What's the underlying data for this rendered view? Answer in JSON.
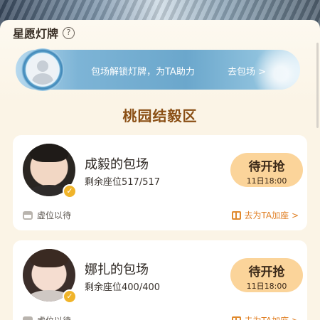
{
  "section": {
    "title": "星愿灯牌",
    "help_icon": "?"
  },
  "banner": {
    "text": "包场解锁灯牌，为TA助力",
    "link": "去包场 >",
    "avatar_icon": "default-user-avatar"
  },
  "zone_title": "桃园结毅区",
  "cards": [
    {
      "title": "成毅的包场",
      "seats": "剩余座位517/517",
      "status": "待开抢",
      "time": "11日18:00",
      "note": "虚位以待",
      "action": "去为TA加座 >",
      "verified_icon": "verified-badge"
    },
    {
      "title": "娜扎的包场",
      "seats": "剩余座位400/400",
      "status": "待开抢",
      "time": "11日18:00",
      "note": "虚位以待",
      "action": "去为TA加座 >",
      "verified_icon": "verified-badge"
    }
  ],
  "colors": {
    "accent": "#e07f24",
    "pill": "#fbd49a",
    "zone_title": "#8a4f15",
    "banner": "#6ba7cc"
  }
}
